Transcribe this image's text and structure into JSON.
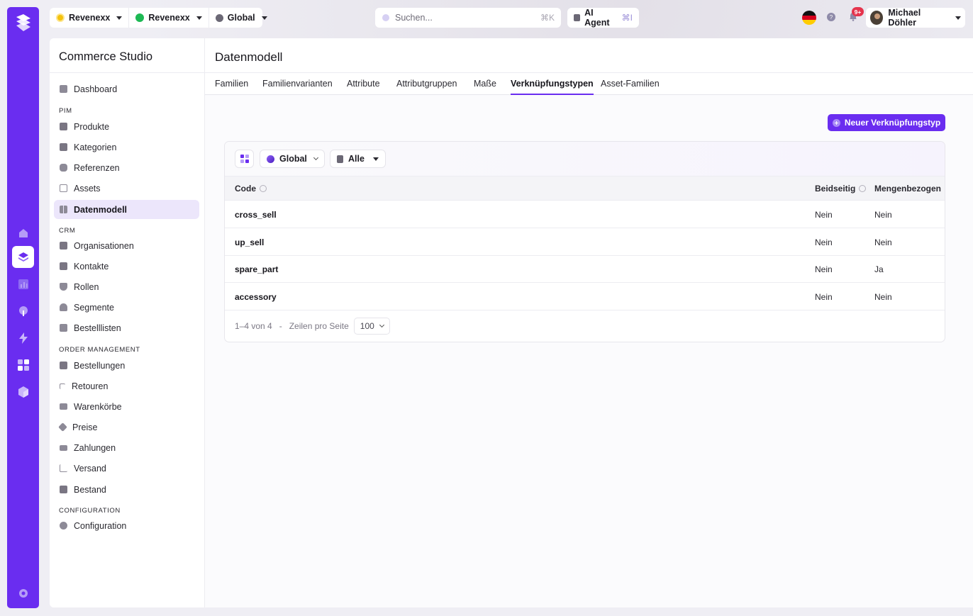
{
  "topbar": {
    "context": [
      {
        "label": "Revenexx",
        "color": "#f4c20d"
      },
      {
        "label": "Revenexx",
        "color": "#1db954"
      },
      {
        "label": "Global",
        "color": "#6b6875"
      }
    ],
    "search": {
      "placeholder": "Suchen...",
      "shortcut": "⌘K"
    },
    "agent": {
      "label": "AI Agent",
      "shortcut": "⌘I"
    },
    "notifications_badge": "9+",
    "user_name": "Michael Döhler"
  },
  "sidebar": {
    "title": "Commerce Studio",
    "items": [
      {
        "label": "Dashboard",
        "icon": "dashboard-icon"
      },
      {
        "section": "PIM"
      },
      {
        "label": "Produkte",
        "icon": "cube-icon"
      },
      {
        "label": "Kategorien",
        "icon": "cube-icon"
      },
      {
        "label": "Referenzen",
        "icon": "database-icon"
      },
      {
        "label": "Assets",
        "icon": "image-icon"
      },
      {
        "label": "Datenmodell",
        "icon": "grid-icon",
        "active": true
      },
      {
        "section": "CRM"
      },
      {
        "label": "Organisationen",
        "icon": "cube-icon"
      },
      {
        "label": "Kontakte",
        "icon": "cube-icon"
      },
      {
        "label": "Rollen",
        "icon": "shield-icon"
      },
      {
        "label": "Segmente",
        "icon": "users-icon"
      },
      {
        "label": "Bestelllisten",
        "icon": "bookmark-icon"
      },
      {
        "section": "ORDER MANAGEMENT"
      },
      {
        "label": "Bestellungen",
        "icon": "cube-icon"
      },
      {
        "label": "Retouren",
        "icon": "return-icon"
      },
      {
        "label": "Warenkörbe",
        "icon": "cart-icon"
      },
      {
        "label": "Preise",
        "icon": "tag-icon"
      },
      {
        "label": "Zahlungen",
        "icon": "card-icon"
      },
      {
        "label": "Versand",
        "icon": "truck-icon"
      },
      {
        "label": "Bestand",
        "icon": "cube-icon"
      },
      {
        "section": "CONFIGURATION"
      },
      {
        "label": "Configuration",
        "icon": "gear-icon"
      }
    ]
  },
  "main": {
    "title": "Datenmodell",
    "tabs": [
      {
        "label": "Familien"
      },
      {
        "label": "Familienvarianten"
      },
      {
        "label": "Attribute"
      },
      {
        "label": "Attributgruppen"
      },
      {
        "label": "Maße"
      },
      {
        "label": "Verknüpfungstypen",
        "active": true
      },
      {
        "label": "Asset-Familien"
      }
    ],
    "new_button": "Neuer Verknüpfungstyp",
    "filters": {
      "scope": "Global",
      "category": "Alle"
    },
    "table": {
      "columns": [
        "Code",
        "Beidseitig",
        "Mengenbezogen"
      ],
      "rows": [
        {
          "code": "cross_sell",
          "beidseitig": "Nein",
          "mengenbezogen": "Nein"
        },
        {
          "code": "up_sell",
          "beidseitig": "Nein",
          "mengenbezogen": "Nein"
        },
        {
          "code": "spare_part",
          "beidseitig": "Nein",
          "mengenbezogen": "Ja"
        },
        {
          "code": "accessory",
          "beidseitig": "Nein",
          "mengenbezogen": "Nein"
        }
      ]
    },
    "pagination": {
      "range": "1–4 von 4",
      "separator": "-",
      "rows_label": "Zeilen pro Seite",
      "rows_value": "100"
    }
  },
  "colors": {
    "accent": "#6a2df0",
    "accent_light": "#ece6fb",
    "badge": "#e5344d"
  }
}
